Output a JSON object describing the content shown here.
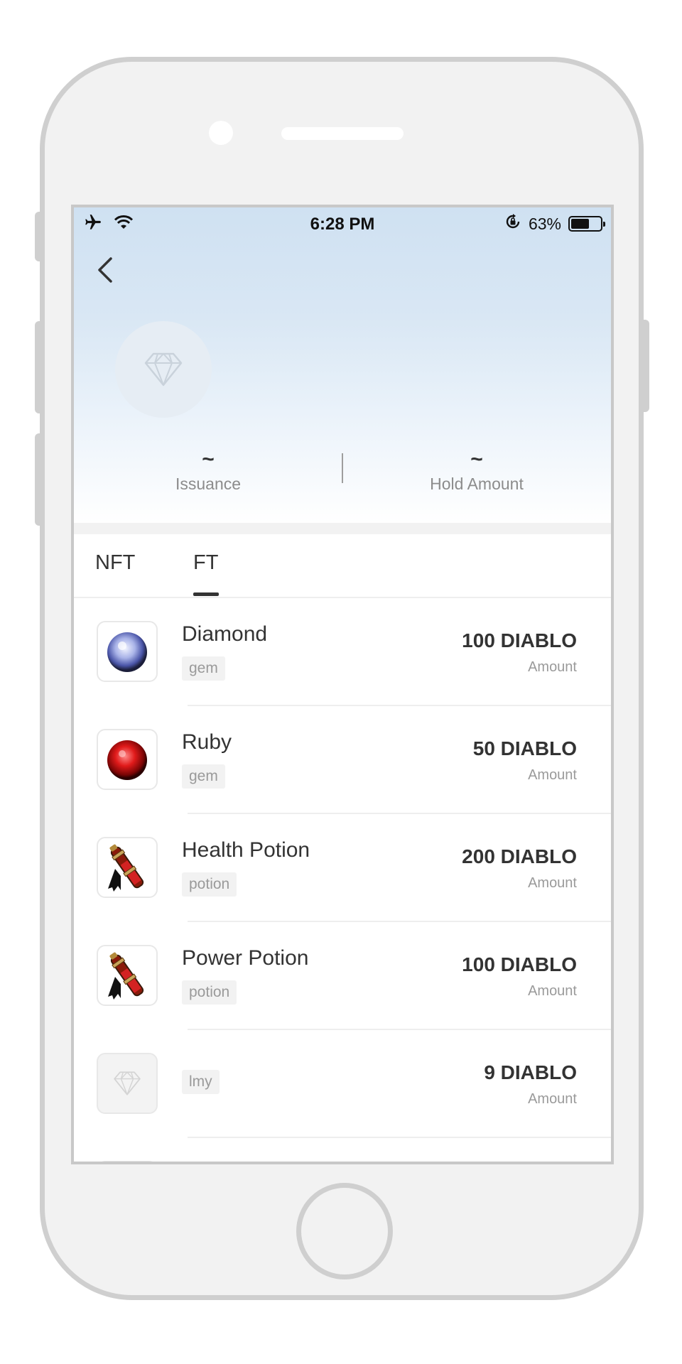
{
  "status_bar": {
    "time": "6:28 PM",
    "battery_percent": "63%",
    "battery_level": 0.63
  },
  "summary": {
    "issuance_value": "~",
    "issuance_label": "Issuance",
    "hold_value": "~",
    "hold_label": "Hold Amount"
  },
  "tabs": [
    {
      "label": "NFT",
      "active": false
    },
    {
      "label": "FT",
      "active": true
    }
  ],
  "items": [
    {
      "name": "Diamond",
      "tag": "gem",
      "amount": "100 DIABLO",
      "amount_label": "Amount",
      "icon": "diamond-gem-icon"
    },
    {
      "name": "Ruby",
      "tag": "gem",
      "amount": "50 DIABLO",
      "amount_label": "Amount",
      "icon": "ruby-gem-icon"
    },
    {
      "name": "Health Potion",
      "tag": "potion",
      "amount": "200 DIABLO",
      "amount_label": "Amount",
      "icon": "health-potion-icon"
    },
    {
      "name": "Power Potion",
      "tag": "potion",
      "amount": "100 DIABLO",
      "amount_label": "Amount",
      "icon": "power-potion-icon"
    },
    {
      "name": "",
      "tag": "lmy",
      "amount": "9 DIABLO",
      "amount_label": "Amount",
      "icon": "placeholder-diamond-icon"
    }
  ]
}
